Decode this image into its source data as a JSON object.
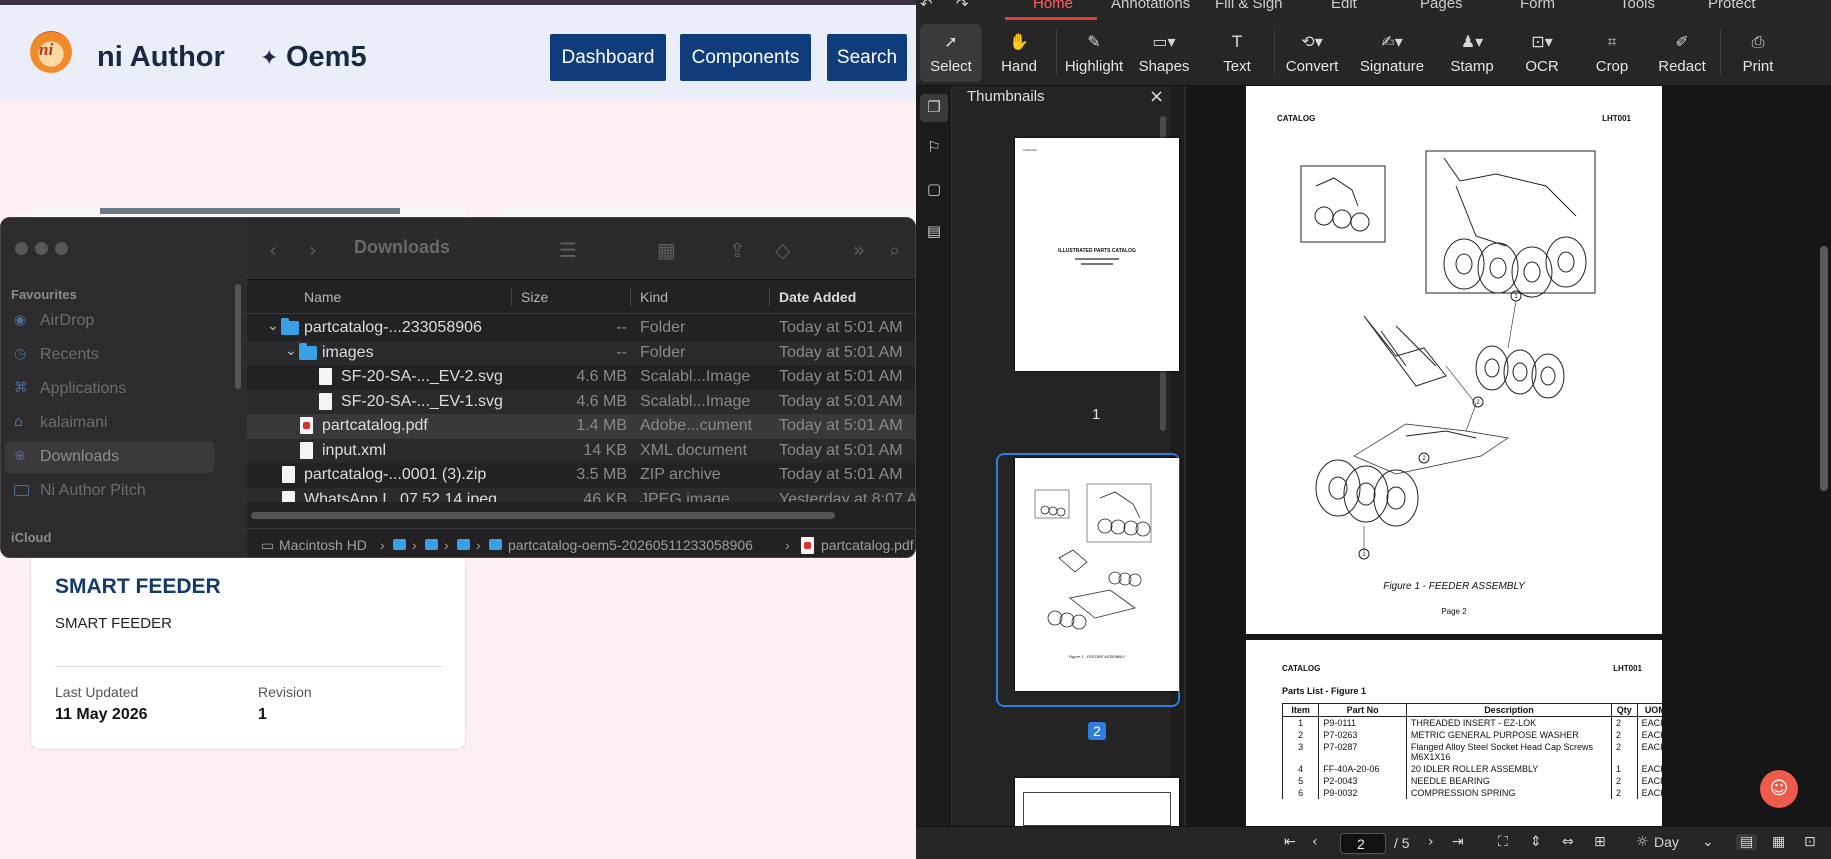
{
  "webapp": {
    "brand": "ni Author",
    "logo_text": "ni",
    "project": "Oem5",
    "nav": [
      "Dashboard",
      "Components",
      "Search"
    ],
    "card": {
      "title": "SMART FEEDER",
      "subtitle": "SMART FEEDER",
      "last_updated_label": "Last Updated",
      "last_updated": "11 May 2026",
      "revision_label": "Revision",
      "revision": "1"
    }
  },
  "finder": {
    "title": "Downloads",
    "sidebar": {
      "favourites_heading": "Favourites",
      "items": [
        "AirDrop",
        "Recents",
        "Applications",
        "kalaimani",
        "Downloads",
        "Ni Author Pitch"
      ],
      "selected": "Downloads",
      "icloud_heading": "iCloud"
    },
    "columns": [
      "Name",
      "Size",
      "Kind",
      "Date Added"
    ],
    "rows": [
      {
        "name": "partcatalog-...233058906",
        "size": "--",
        "kind": "Folder",
        "date": "Today at 5:01 AM"
      },
      {
        "name": "images",
        "size": "--",
        "kind": "Folder",
        "date": "Today at 5:01 AM"
      },
      {
        "name": "SF-20-SA-..._EV-2.svg",
        "size": "4.6 MB",
        "kind": "Scalabl...Image",
        "date": "Today at 5:01 AM"
      },
      {
        "name": "SF-20-SA-..._EV-1.svg",
        "size": "4.6 MB",
        "kind": "Scalabl...Image",
        "date": "Today at 5:01 AM"
      },
      {
        "name": "partcatalog.pdf",
        "size": "1.4 MB",
        "kind": "Adobe...cument",
        "date": "Today at 5:01 AM"
      },
      {
        "name": "input.xml",
        "size": "14 KB",
        "kind": "XML document",
        "date": "Today at 5:01 AM"
      },
      {
        "name": "partcatalog-...0001 (3).zip",
        "size": "3.5 MB",
        "kind": "ZIP archive",
        "date": "Today at 5:01 AM"
      },
      {
        "name": "WhatsApp I...07.52.14.jpeg",
        "size": "46 KB",
        "kind": "JPEG image",
        "date": "Yesterday at 8:07 A"
      }
    ],
    "path": [
      "Macintosh HD",
      "partcatalog-oem5-20260511233058906",
      "partcatalog.pdf"
    ]
  },
  "pdf": {
    "menu_tabs": [
      "Home",
      "Annotations",
      "Fill & Sign",
      "Edit",
      "Pages",
      "Form",
      "Tools",
      "Protect"
    ],
    "active_tab": "Home",
    "tools": [
      "Select",
      "Hand",
      "Highlight",
      "Shapes",
      "Text",
      "Convert",
      "Signature",
      "Stamp",
      "OCR",
      "Crop",
      "Redact",
      "Print"
    ],
    "thumbnails_title": "Thumbnails",
    "thumb_numbers": [
      "1",
      "2"
    ],
    "page1_title": "ILLUSTRATED PARTS CATALOG",
    "page_header_left": "CATALOG",
    "page_header_right": "LHT001",
    "figure_caption": "Figure 1 - FEEDER ASSEMBLY",
    "page_label": "Page 2",
    "parts_list_title": "Parts List - Figure 1",
    "parts_columns": [
      "Item",
      "Part No",
      "Description",
      "Qty",
      "UOM"
    ],
    "parts": [
      [
        "1",
        "P9-0111",
        "THREADED INSERT - EZ-LOK",
        "2",
        "EACH"
      ],
      [
        "2",
        "P7-0263",
        "METRIC GENERAL PURPOSE WASHER",
        "2",
        "EACH"
      ],
      [
        "3",
        "P7-0287",
        "Flanged Alloy Steel Socket Head Cap Screws M6X1X16",
        "2",
        "EACH"
      ],
      [
        "4",
        "FF-40A-20-06",
        "20 IDLER ROLLER ASSEMBLY",
        "1",
        "EACH"
      ],
      [
        "5",
        "P2-0043",
        "NEEDLE BEARING",
        "2",
        "EACH"
      ],
      [
        "6",
        "P9-0032",
        "COMPRESSION SPRING",
        "2",
        "EACH"
      ]
    ],
    "callouts": [
      "1",
      "2",
      "2",
      "1"
    ],
    "current_page": "2",
    "total_pages": "/ 5",
    "view_mode": "Day"
  }
}
